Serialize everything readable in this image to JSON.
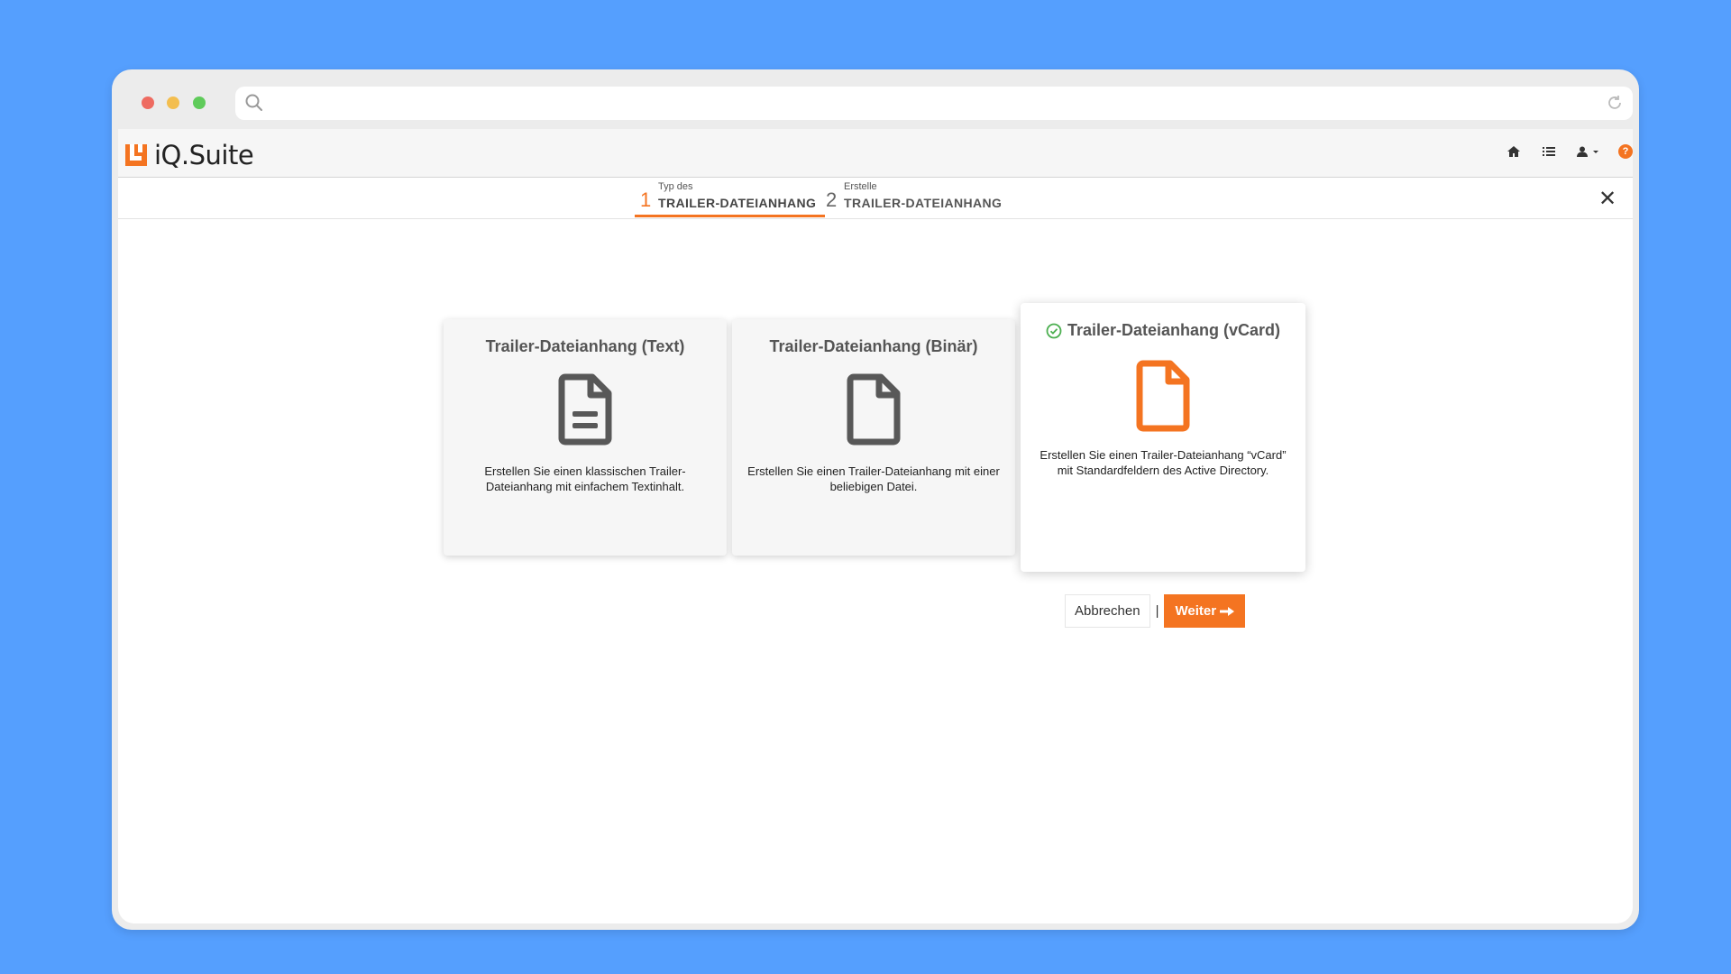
{
  "app": {
    "name": "iQ.Suite"
  },
  "browser": {
    "url": ""
  },
  "steps": [
    {
      "number": "1",
      "label_small": "Typ des",
      "label_big": "TRAILER-DATEIANHANG"
    },
    {
      "number": "2",
      "label_small": "Erstelle",
      "label_big": "TRAILER-DATEIANHANG"
    }
  ],
  "cards": [
    {
      "title": "Trailer-Dateianhang (Text)",
      "description": "Erstellen Sie einen klassischen Trailer-Dateianhang mit einfachem Textinhalt."
    },
    {
      "title": "Trailer-Dateianhang (Binär)",
      "description": "Erstellen Sie einen Trailer-Dateianhang mit einer beliebigen Datei."
    },
    {
      "title": "Trailer-Dateianhang (vCard)",
      "description": "Erstellen Sie einen Trailer-Dateianhang “vCard” mit Standardfeldern des Active Directory.",
      "selected": true
    }
  ],
  "actions": {
    "cancel": "Abbrechen",
    "separator": "|",
    "next": "Weiter"
  },
  "nav": {
    "help": "?"
  },
  "colors": {
    "accent": "#f47421",
    "background": "#559ffe",
    "check": "#4caf50"
  }
}
